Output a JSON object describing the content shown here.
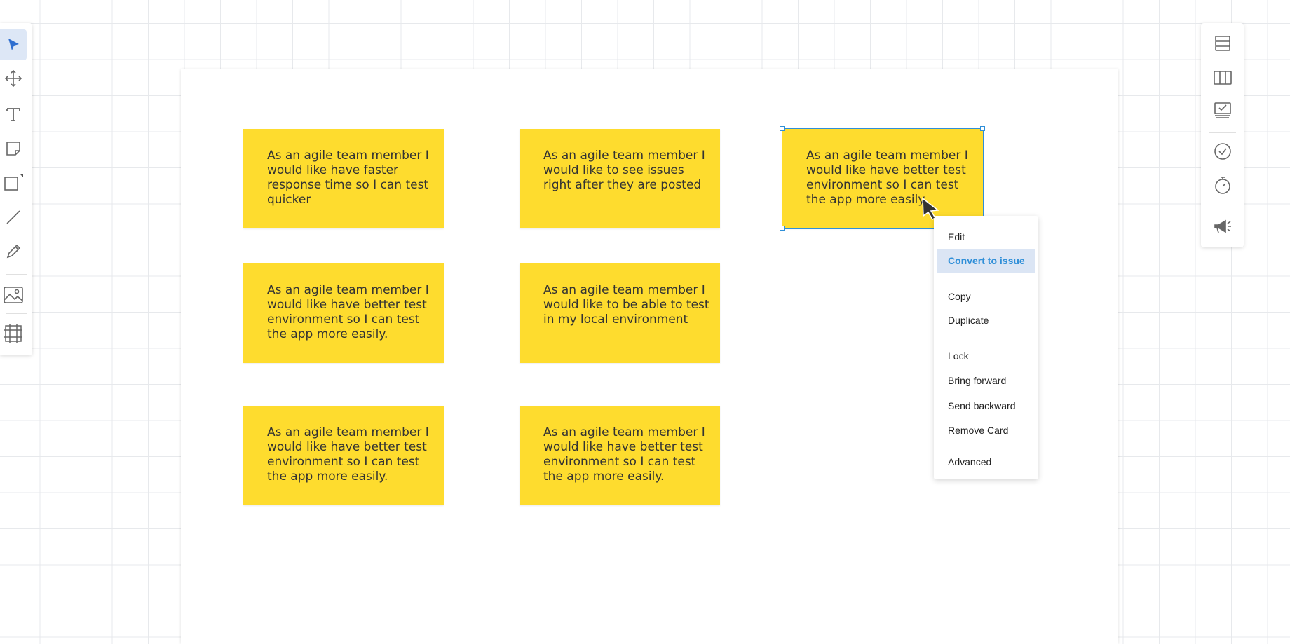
{
  "canvas": {
    "cards": [
      {
        "text": "As an agile team member I would like have faster response time so I can test quicker"
      },
      {
        "text": "As an agile team member I would like to see issues right after they are posted"
      },
      {
        "text": "As an agile team member I would like have better test environment so I can test the app more easily.",
        "selected": true
      },
      {
        "text": "As an agile team member I would like have better test environment so I can test the app more easily."
      },
      {
        "text": "As an agile team member I would like to be able to test in my local environment"
      },
      {
        "text": "As an agile team member I would like have better test environment so I can test the app more easily."
      },
      {
        "text": "As an agile team member I would like have better test environment so I can test the app more easily."
      }
    ],
    "card_color": "#fedc2e",
    "selection_color": "#2f8fd8"
  },
  "left_toolbar": {
    "tools": [
      "select-icon",
      "move-icon",
      "text-icon",
      "sticky-note-icon",
      "shape-icon",
      "line-icon",
      "pen-icon",
      "image-icon",
      "frame-icon"
    ],
    "active": "select-icon"
  },
  "right_toolbar": {
    "tools": [
      "list-icon",
      "board-columns-icon",
      "task-board-icon",
      "checkmark-circle-icon",
      "timer-icon",
      "announce-icon"
    ]
  },
  "context_menu": {
    "items": [
      {
        "label": "Edit"
      },
      {
        "label": "Convert to issue",
        "highlighted": true
      },
      {
        "label": "Copy"
      },
      {
        "label": "Duplicate"
      },
      {
        "label": "Lock"
      },
      {
        "label": "Bring forward"
      },
      {
        "label": "Send backward"
      },
      {
        "label": "Remove Card"
      },
      {
        "label": "Advanced"
      }
    ]
  }
}
